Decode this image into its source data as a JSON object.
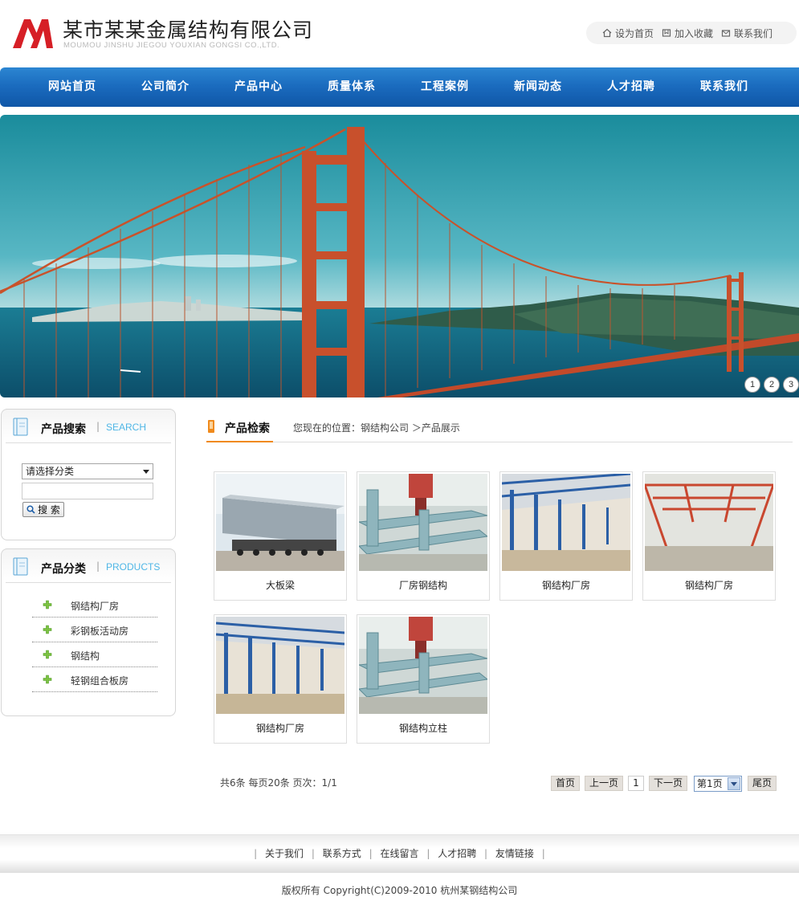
{
  "header": {
    "company_name": "某市某某金属结构有限公司",
    "company_en": "MOUMOU JINSHU JIEGOU YOUXIAN GONGSI CO.,LTD.",
    "toplinks": [
      {
        "label": "设为首页",
        "icon": "home-icon"
      },
      {
        "label": "加入收藏",
        "icon": "bookmark-icon"
      },
      {
        "label": "联系我们",
        "icon": "contact-icon"
      }
    ]
  },
  "nav": [
    "网站首页",
    "公司简介",
    "产品中心",
    "质量体系",
    "工程案例",
    "新闻动态",
    "人才招聘",
    "联系我们"
  ],
  "banner": {
    "slides": [
      "1",
      "2",
      "3"
    ]
  },
  "search_box": {
    "title": "产品搜索",
    "title_en": "SEARCH",
    "select_value": "请选择分类",
    "button": "搜 索"
  },
  "category_box": {
    "title": "产品分类",
    "title_en": "PRODUCTS",
    "items": [
      "钢结构厂房",
      "彩钢板活动房",
      "钢结构",
      "轻钢组合板房"
    ]
  },
  "main": {
    "title": "产品检索",
    "breadcrumb": "您现在的位置：钢结构公司 ＞产品展示",
    "products": [
      "大板梁",
      "厂房钢结构",
      "钢结构厂房",
      "钢结构厂房",
      "钢结构厂房",
      "钢结构立柱"
    ]
  },
  "pager": {
    "info": "共6条  每页20条  页次：1/1",
    "first": "首页",
    "prev": "上一页",
    "current": "1",
    "next": "下一页",
    "select": "第1页",
    "last": "尾页"
  },
  "footer": {
    "links": [
      "关于我们",
      "联系方式",
      "在线留言",
      "人才招聘",
      "友情链接"
    ],
    "copyright": "版权所有  Copyright(C)2009-2010 杭州某钢结构公司"
  },
  "colors": {
    "nav": "#1b6cbf",
    "accent": "#f08a1c",
    "en_label": "#4fb6e6"
  }
}
